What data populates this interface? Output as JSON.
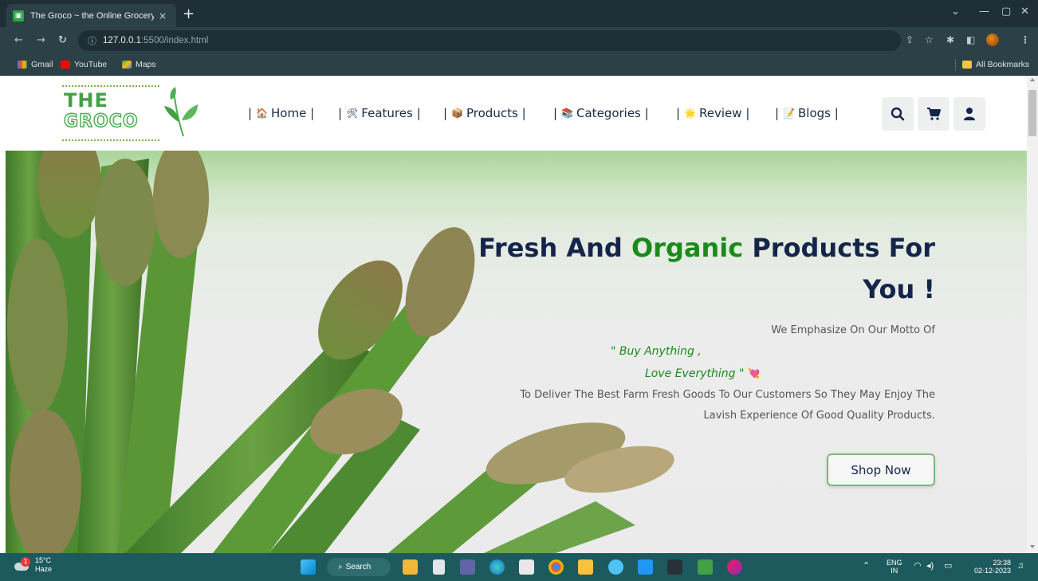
{
  "browser": {
    "tab_title": "The Groco ~ the Online Grocery Store",
    "tab_close": "×",
    "new_tab": "+",
    "url_host": "127.0.0.1",
    "url_rest": ":5500/index.html",
    "bookmarks": [
      {
        "label": "Gmail",
        "color": "#ea4335"
      },
      {
        "label": "YouTube",
        "color": "#ff0000"
      },
      {
        "label": "Maps",
        "color": "#34a853"
      }
    ],
    "all_bookmarks": "All Bookmarks"
  },
  "logo": {
    "line1": "THE",
    "line2": "GROCO"
  },
  "nav": {
    "items": [
      {
        "label": "Home",
        "icon": "home-icon",
        "glyph": "🏠"
      },
      {
        "label": "Features",
        "icon": "tools-icon",
        "glyph": "🛠"
      },
      {
        "label": "Products",
        "icon": "package-icon",
        "glyph": "📦"
      },
      {
        "label": "Categories",
        "icon": "books-icon",
        "glyph": "📚"
      },
      {
        "label": "Review",
        "icon": "star-icon",
        "glyph": "🌟"
      },
      {
        "label": "Blogs",
        "icon": "memo-icon",
        "glyph": "📝"
      }
    ]
  },
  "header_buttons": {
    "search": "search-icon",
    "cart": "cart-icon",
    "user": "user-icon"
  },
  "hero": {
    "title_part1": "Fresh And ",
    "title_highlight": "Organic",
    "title_part2": " Products For",
    "title_line2": "You !",
    "motto": "We Emphasize On Our Motto Of",
    "quote1": "\" Buy Anything ,",
    "quote2": "Love Everything \"",
    "desc_line1": "To Deliver The Best Farm Fresh Goods To Our Customers So They May Enjoy The",
    "desc_line2": "Lavish Experience Of Good Quality Products.",
    "cta": "Shop Now",
    "accent": "#1a8a1a",
    "title_color": "#15254a"
  },
  "taskbar": {
    "weather_temp": "15°C",
    "weather_desc": "Haze",
    "search_label": "Search",
    "lang_top": "ENG",
    "lang_bottom": "IN",
    "time": "23:38",
    "date": "02-12-2023"
  }
}
